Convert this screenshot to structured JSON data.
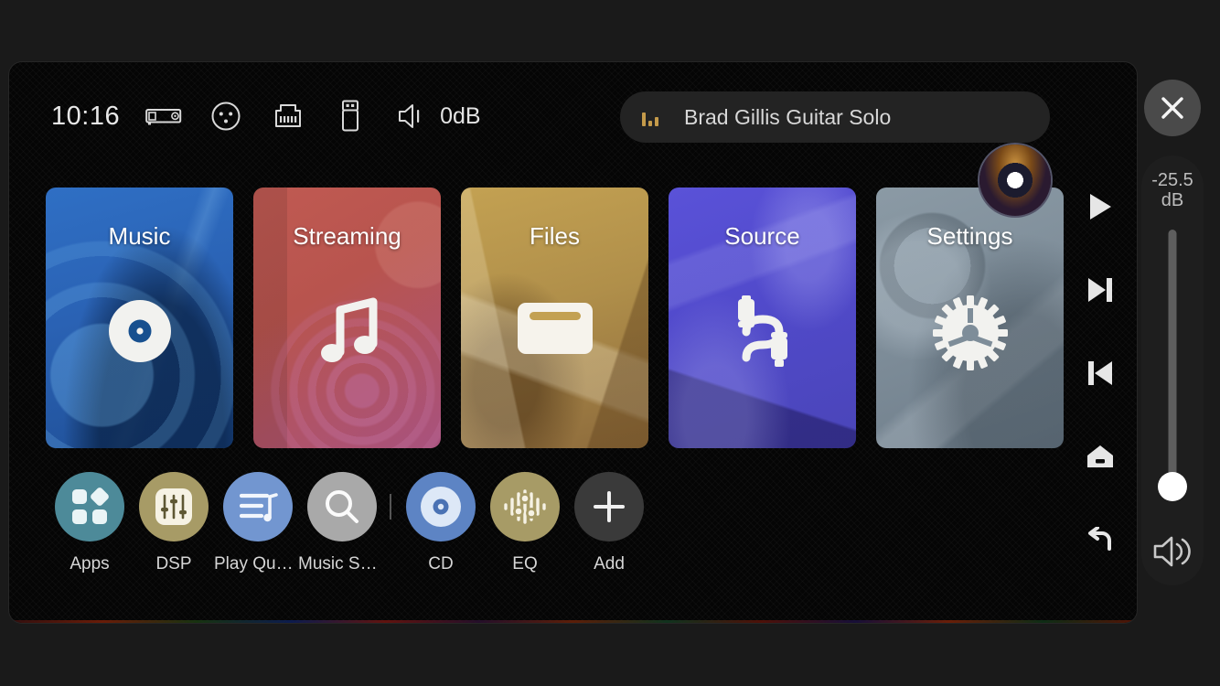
{
  "window": {
    "accent_background": "#050505",
    "desktop_background": "#1a1a1a"
  },
  "status_bar": {
    "clock": "10:16",
    "volume_db": "0dB",
    "icons": [
      {
        "name": "device-amplifier-icon",
        "label": "Device"
      },
      {
        "name": "xlr-connector-icon",
        "label": "XLR"
      },
      {
        "name": "ethernet-port-icon",
        "label": "Network"
      },
      {
        "name": "usb-drive-icon",
        "label": "USB"
      },
      {
        "name": "speaker-icon",
        "label": "Volume"
      }
    ]
  },
  "now_playing": {
    "title": "Brad Gillis Guitar Solo",
    "eq_icon": "equalizer-bars-icon",
    "eq_color": "#c49a4a",
    "album_art": "album-art-cd"
  },
  "close_button": {
    "label": "Close",
    "icon": "close-icon"
  },
  "tiles": [
    {
      "label": "Music",
      "icon": "vinyl-record-icon",
      "color": "#2f6fc4",
      "class": "t-music"
    },
    {
      "label": "Streaming",
      "icon": "music-note-icon",
      "color": "#c05a52",
      "class": "t-stream"
    },
    {
      "label": "Files",
      "icon": "folder-icon",
      "color": "#c3a152",
      "class": "t-files"
    },
    {
      "label": "Source",
      "icon": "rca-cable-icon",
      "color": "#5a52d8",
      "class": "t-source"
    },
    {
      "label": "Settings",
      "icon": "gear-icon",
      "color": "#8b9aa5",
      "class": "t-settings"
    }
  ],
  "dock": [
    {
      "label": "Apps",
      "icon": "apps-grid-icon",
      "color": "#4d8a99"
    },
    {
      "label": "DSP",
      "icon": "sliders-icon",
      "color": "#a79b66"
    },
    {
      "label": "Play Queue",
      "icon": "playlist-icon",
      "color": "#7296d0"
    },
    {
      "label": "Music Se…",
      "icon": "search-icon",
      "color": "#a9a9a9"
    },
    {
      "label": "CD",
      "icon": "cd-disc-icon",
      "color": "#5d84c4"
    },
    {
      "label": "EQ",
      "icon": "equalizer-icon",
      "color": "#a79b66"
    },
    {
      "label": "Add",
      "icon": "plus-icon",
      "color": "#3a3a3a"
    }
  ],
  "right_rail": [
    {
      "name": "play-button",
      "icon": "play-icon",
      "label": "Play"
    },
    {
      "name": "next-button",
      "icon": "next-icon",
      "label": "Next"
    },
    {
      "name": "previous-button",
      "icon": "previous-icon",
      "label": "Previous"
    },
    {
      "name": "home-button",
      "icon": "home-icon",
      "label": "Home"
    },
    {
      "name": "back-button",
      "icon": "back-icon",
      "label": "Back"
    }
  ],
  "volume": {
    "value": "-25.5",
    "unit": "dB",
    "speaker_icon": "speaker-waves-icon",
    "thumb_position_percent": 9
  }
}
